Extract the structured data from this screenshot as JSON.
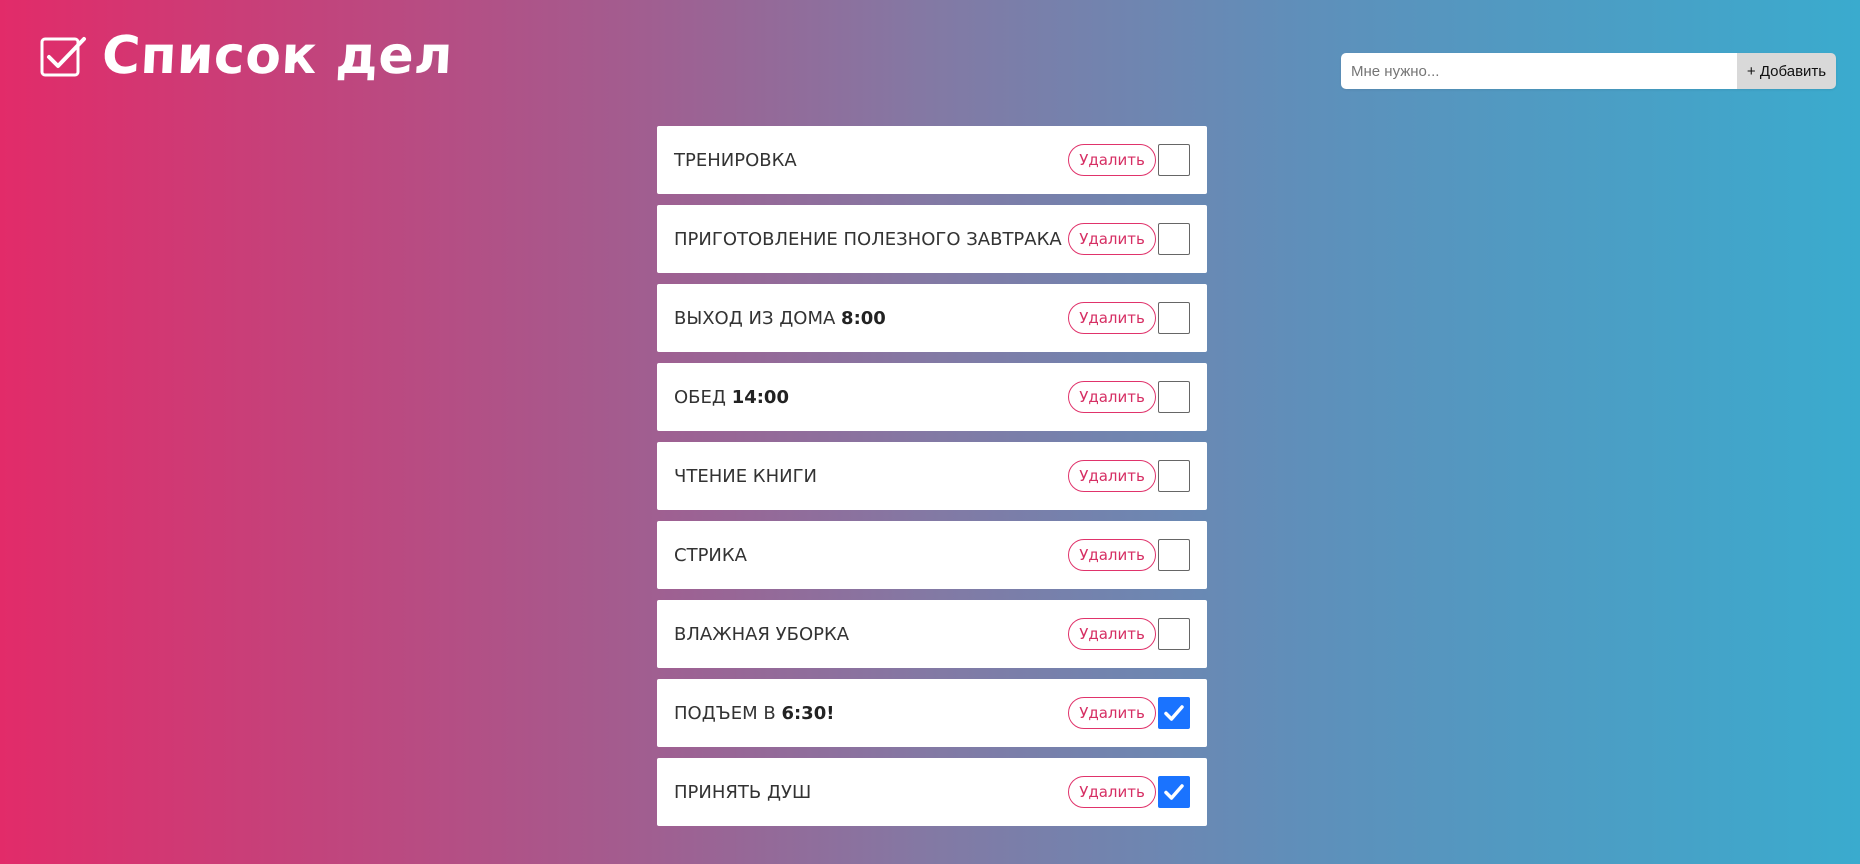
{
  "header": {
    "title": "Список дел",
    "logo_icon": "checkbox-checked-icon"
  },
  "add_form": {
    "placeholder": "Мне нужно...",
    "value": "",
    "button_label": "+ Добавить"
  },
  "colors": {
    "gradient_left": "#e22b69",
    "gradient_right": "#3aabce",
    "delete_accent": "#e0336b",
    "checkbox_checked": "#1a73ff"
  },
  "tasks": [
    {
      "text": "Тренировка",
      "time": "",
      "suffix": "",
      "delete_label": "Удалить",
      "checked": false
    },
    {
      "text": "Приготовление полезного завтрака",
      "time": "",
      "suffix": "",
      "delete_label": "Удалить",
      "checked": false
    },
    {
      "text": "Выход из дома ",
      "time": "8:00",
      "suffix": "",
      "delete_label": "Удалить",
      "checked": false
    },
    {
      "text": "Обед ",
      "time": "14:00",
      "suffix": "",
      "delete_label": "Удалить",
      "checked": false
    },
    {
      "text": "Чтение книги",
      "time": "",
      "suffix": "",
      "delete_label": "Удалить",
      "checked": false
    },
    {
      "text": "Стрика",
      "time": "",
      "suffix": "",
      "delete_label": "Удалить",
      "checked": false
    },
    {
      "text": "Влажная уборка",
      "time": "",
      "suffix": "",
      "delete_label": "Удалить",
      "checked": false
    },
    {
      "text": "Подъем в ",
      "time": "6:30",
      "suffix": "!",
      "delete_label": "Удалить",
      "checked": true
    },
    {
      "text": "Принять душ",
      "time": "",
      "suffix": "",
      "delete_label": "Удалить",
      "checked": true
    }
  ]
}
